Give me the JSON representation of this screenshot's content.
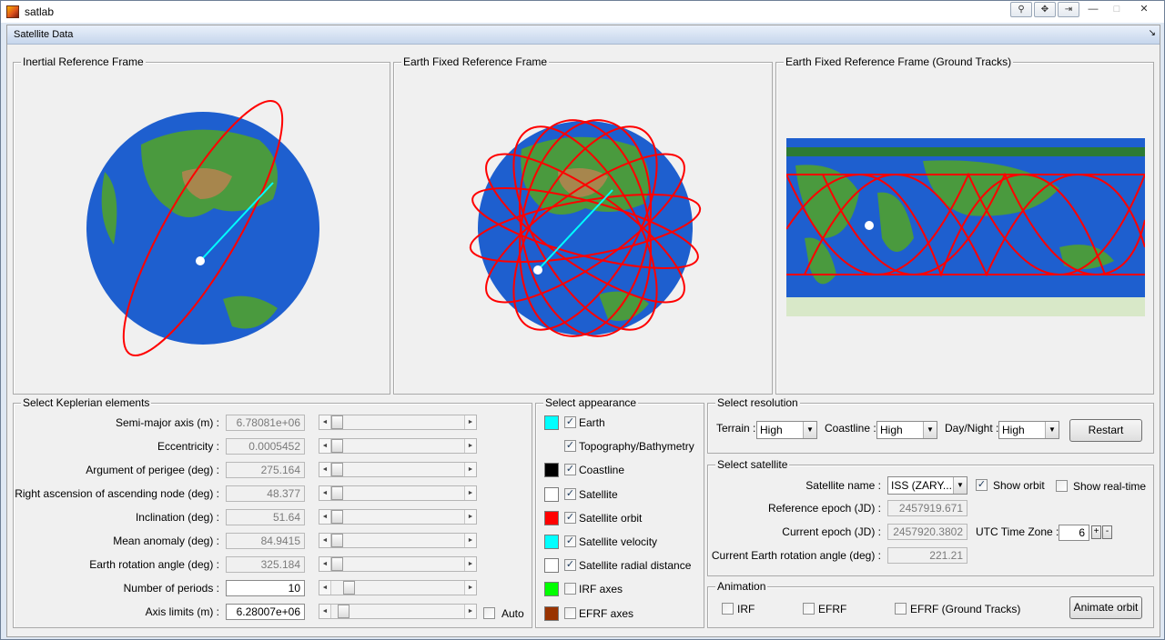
{
  "window": {
    "title": "satlab",
    "toolbar_icons": [
      "pin-icon",
      "pan-icon",
      "dock-icon"
    ],
    "minimize": "—",
    "maximize": "□",
    "close": "✕"
  },
  "header": {
    "label": "Satellite Data",
    "expand_icon": "↘"
  },
  "frames": {
    "inertial": "Inertial Reference Frame",
    "earth_fixed": "Earth Fixed Reference Frame",
    "ground_tracks": "Earth Fixed Reference Frame (Ground Tracks)"
  },
  "kepler": {
    "title": "Select Keplerian elements",
    "rows": [
      {
        "label": "Semi-major axis (m) :",
        "value": "6.78081e+06",
        "editable": false,
        "slider": 0.0
      },
      {
        "label": "Eccentricity :",
        "value": "0.0005452",
        "editable": false,
        "slider": 0.0
      },
      {
        "label": "Argument of perigee (deg) :",
        "value": "275.164",
        "editable": false,
        "slider": 0.0
      },
      {
        "label": "Right ascension of ascending node (deg) :",
        "value": "48.377",
        "editable": false,
        "slider": 0.0
      },
      {
        "label": "Inclination (deg) :",
        "value": "51.64",
        "editable": false,
        "slider": 0.0
      },
      {
        "label": "Mean anomaly (deg) :",
        "value": "84.9415",
        "editable": false,
        "slider": 0.0
      },
      {
        "label": "Earth rotation angle (deg) :",
        "value": "325.184",
        "editable": false,
        "slider": 0.0
      },
      {
        "label": "Number of periods :",
        "value": "10",
        "editable": true,
        "slider": 0.1
      },
      {
        "label": "Axis limits (m) :",
        "value": "6.28007e+06",
        "editable": true,
        "slider": 0.05
      }
    ],
    "auto_label": "Auto"
  },
  "appearance": {
    "title": "Select appearance",
    "items": [
      {
        "label": "Earth",
        "checked": true,
        "color": "#00ffff"
      },
      {
        "label": "Topography/Bathymetry",
        "checked": true,
        "color": ""
      },
      {
        "label": "Coastline",
        "checked": true,
        "color": "#000000"
      },
      {
        "label": "Satellite",
        "checked": true,
        "color": "#ffffff"
      },
      {
        "label": "Satellite orbit",
        "checked": true,
        "color": "#ff0000"
      },
      {
        "label": "Satellite velocity",
        "checked": true,
        "color": "#00ffff"
      },
      {
        "label": "Satellite radial distance",
        "checked": true,
        "color": "#ffffff"
      },
      {
        "label": "IRF axes",
        "checked": false,
        "color": "#00ff00"
      },
      {
        "label": "EFRF axes",
        "checked": false,
        "color": "#993300"
      }
    ]
  },
  "resolution": {
    "title": "Select resolution",
    "terrain_label": "Terrain :",
    "terrain_value": "High",
    "coastline_label": "Coastline :",
    "coastline_value": "High",
    "daynight_label": "Day/Night :",
    "daynight_value": "High",
    "restart": "Restart"
  },
  "satellite": {
    "title": "Select satellite",
    "name_label": "Satellite name :",
    "name_value": "ISS (ZARY...",
    "show_orbit": "Show orbit",
    "show_orbit_checked": true,
    "show_realtime": "Show real-time",
    "show_realtime_checked": false,
    "ref_epoch_label": "Reference epoch (JD) :",
    "ref_epoch": "2457919.671",
    "cur_epoch_label": "Current epoch (JD) :",
    "cur_epoch": "2457920.3802",
    "utc_label": "UTC Time Zone :",
    "utc_value": "6",
    "plus": "+",
    "minus": "-",
    "rot_label": "Current Earth rotation angle (deg) :",
    "rot_value": "221.21"
  },
  "animation": {
    "title": "Animation",
    "irf": "IRF",
    "efrf": "EFRF",
    "efrf_gt": "EFRF (Ground Tracks)",
    "animate": "Animate orbit"
  },
  "colors": {
    "orbit": "#ff0000",
    "velocity": "#00ffff",
    "ocean": "#1a5fd0",
    "land": "#3e8f3a",
    "frame_bg": "#f0f0f0"
  }
}
